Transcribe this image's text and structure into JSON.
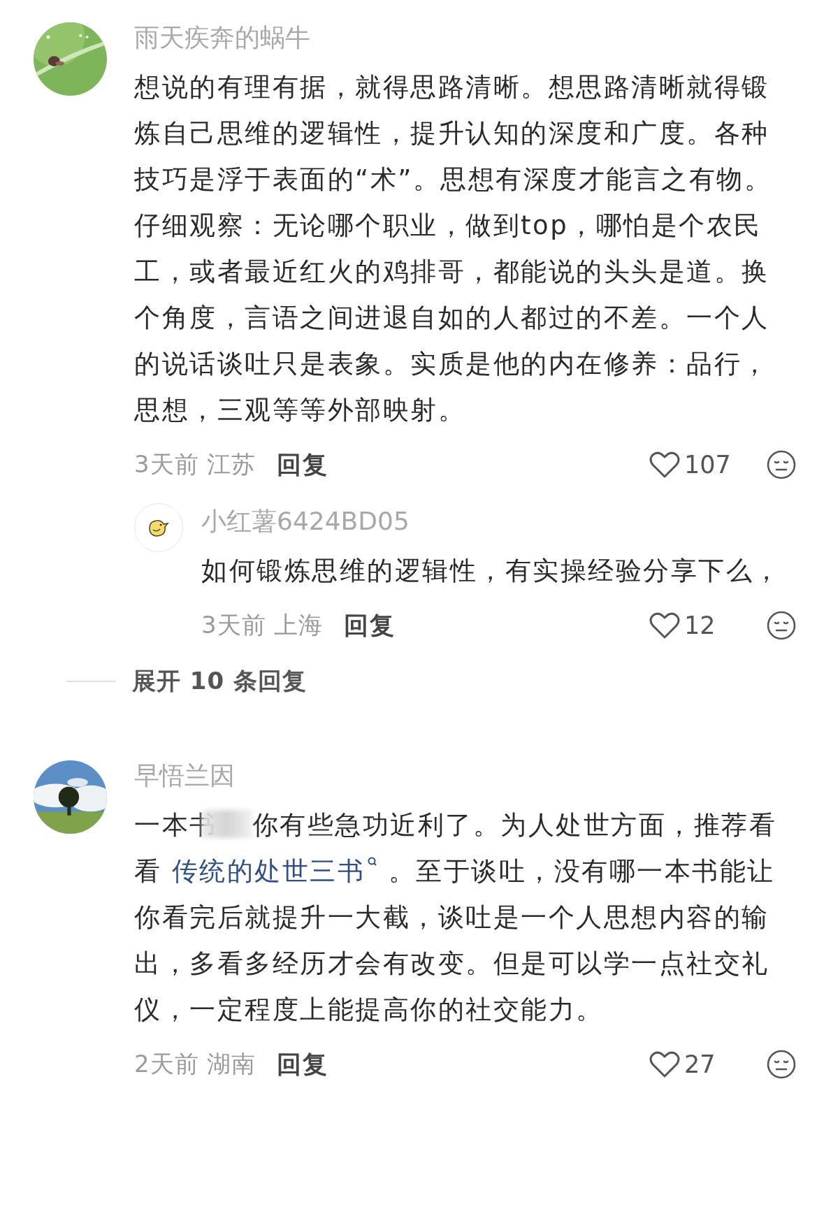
{
  "comments": [
    {
      "author": "雨天疾奔的蜗牛",
      "avatar": {
        "kind": "picture"
      },
      "body": [
        {
          "kind": "text",
          "text": "想说的有理有据，就得思路清晰。想思路清晰就得锻炼自己思维的逻辑性，提升认知的深度和广度。各种技巧是浮于表面的“术”。思想有深度才能言之有物。仔细观察：无论哪个职业，做到top，哪怕是个农民工，或者最近红火的鸡排哥，都能说的头头是道。换个角度，言语之间进退自如的人都过的不差。一个人的说话谈吐只是表象。实质是他的内在修养：品行，思想，三观等等外部映射。"
        }
      ],
      "time": "3天前",
      "location": "江苏",
      "reply_label": "回复",
      "likes": "107",
      "replies": [
        {
          "author": "小红薯6424BD05",
          "avatar": {
            "kind": "default"
          },
          "body": [
            {
              "kind": "text",
              "text": "如何锻炼思维的逻辑性，有实操经验分享下么，"
            }
          ],
          "time": "3天前",
          "location": "上海",
          "reply_label": "回复",
          "likes": "12"
        }
      ],
      "expand_label": "展开 10 条回复"
    },
    {
      "author": "早悟兰因",
      "avatar": {
        "kind": "picture"
      },
      "body": [
        {
          "kind": "text",
          "text": "一本书"
        },
        {
          "kind": "redaction"
        },
        {
          "kind": "text",
          "text": "你有些急功近利了。为人处世方面，推荐看看 "
        },
        {
          "kind": "link",
          "text": "传统的处世三书"
        },
        {
          "kind": "text",
          "text": " 。至于谈吐，没有哪一本书能让你看完后就提升一大截，谈吐是一个人思想内容的输出，多看多经历才会有改变。但是可以学一点社交礼仪，一定程度上能提高你的社交能力。"
        }
      ],
      "time": "2天前",
      "location": "湖南",
      "reply_label": "回复",
      "likes": "27"
    }
  ]
}
